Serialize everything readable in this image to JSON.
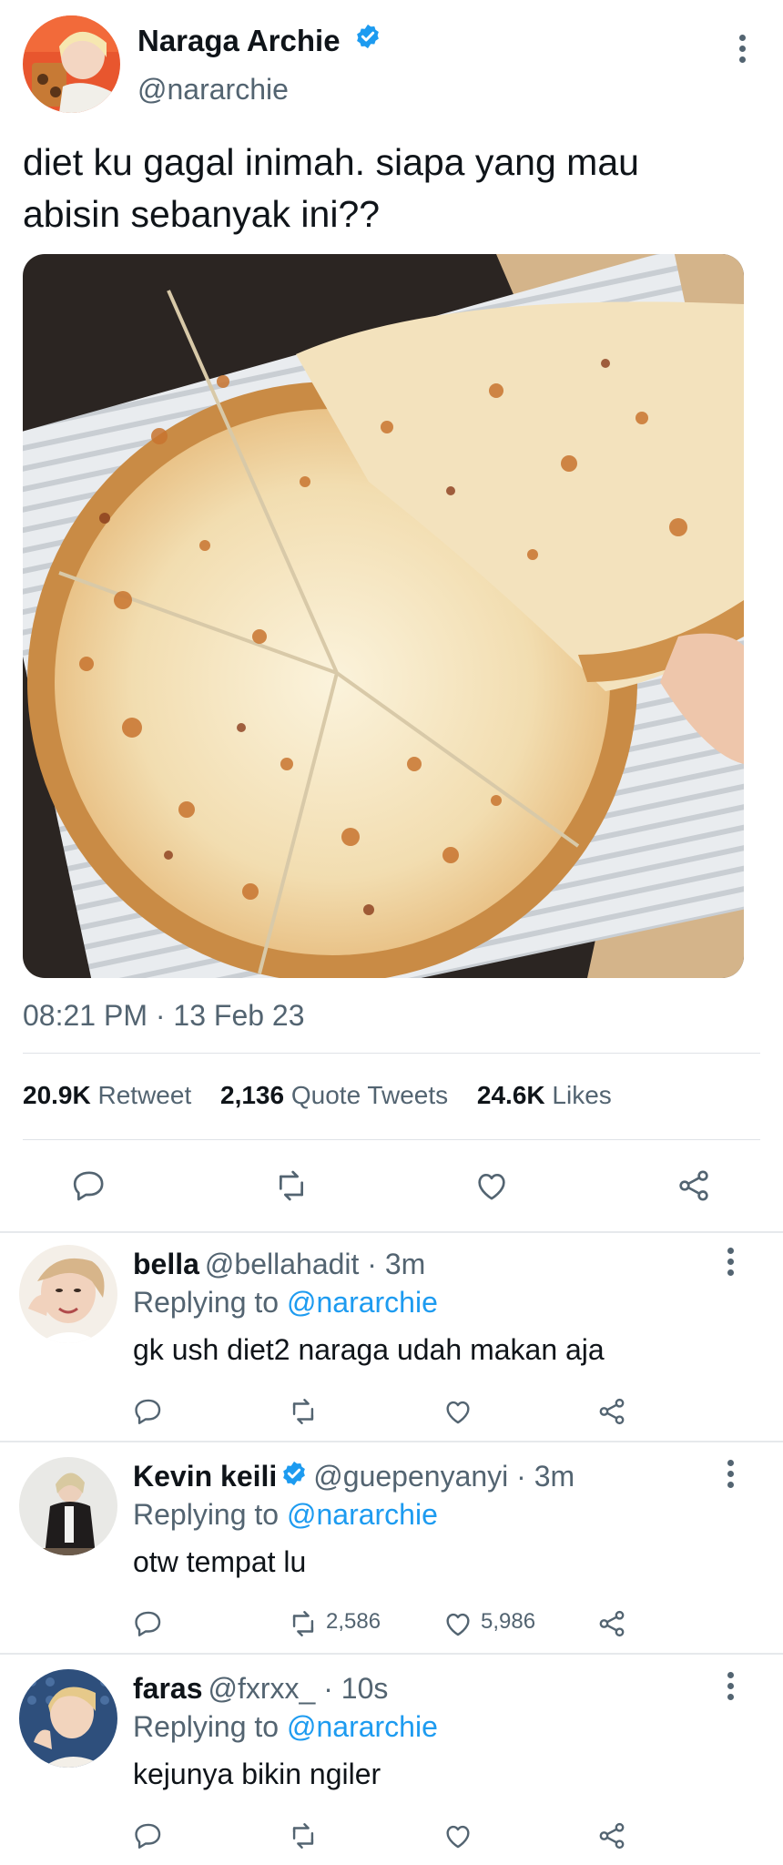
{
  "tweet": {
    "author_name": "Naraga Archie",
    "author_handle": "@nararchie",
    "verified": true,
    "text_line1": "diet ku gagal inimah. siapa yang mau",
    "text_line2": "abisin sebanyak ini??",
    "timestamp": "08:21 PM · 13 Feb 23",
    "stats": {
      "retweets": "20.9K",
      "retweets_label": "Retweet",
      "quotes": "2,136",
      "quotes_label": "Quote Tweets",
      "likes": "24.6K",
      "likes_label": "Likes"
    },
    "actions": [
      "reply-icon",
      "retweet-icon",
      "like-icon",
      "share-icon"
    ]
  },
  "replies": [
    {
      "name": "bella",
      "verified": false,
      "handle": "@bellahadit",
      "time": "3m",
      "replying_label": "Replying to",
      "mention": "@nararchie",
      "text": "gk ush diet2 naraga udah makan aja",
      "retweet_count": "",
      "like_count": ""
    },
    {
      "name": "Kevin keili",
      "verified": true,
      "handle": "@guepenyanyi",
      "time": "3m",
      "replying_label": "Replying to",
      "mention": "@nararchie",
      "text": "otw tempat lu",
      "retweet_count": "2,586",
      "like_count": "5,986"
    },
    {
      "name": "faras",
      "verified": false,
      "handle": "@fxrxx_",
      "time": "10s",
      "replying_label": "Replying to",
      "mention": "@nararchie",
      "text": "kejunya bikin ngiler",
      "retweet_count": "",
      "like_count": ""
    }
  ],
  "colors": {
    "accent": "#1d9bf0",
    "text_primary": "#0f1419",
    "text_secondary": "#536471",
    "divider": "#e6e9ec"
  }
}
